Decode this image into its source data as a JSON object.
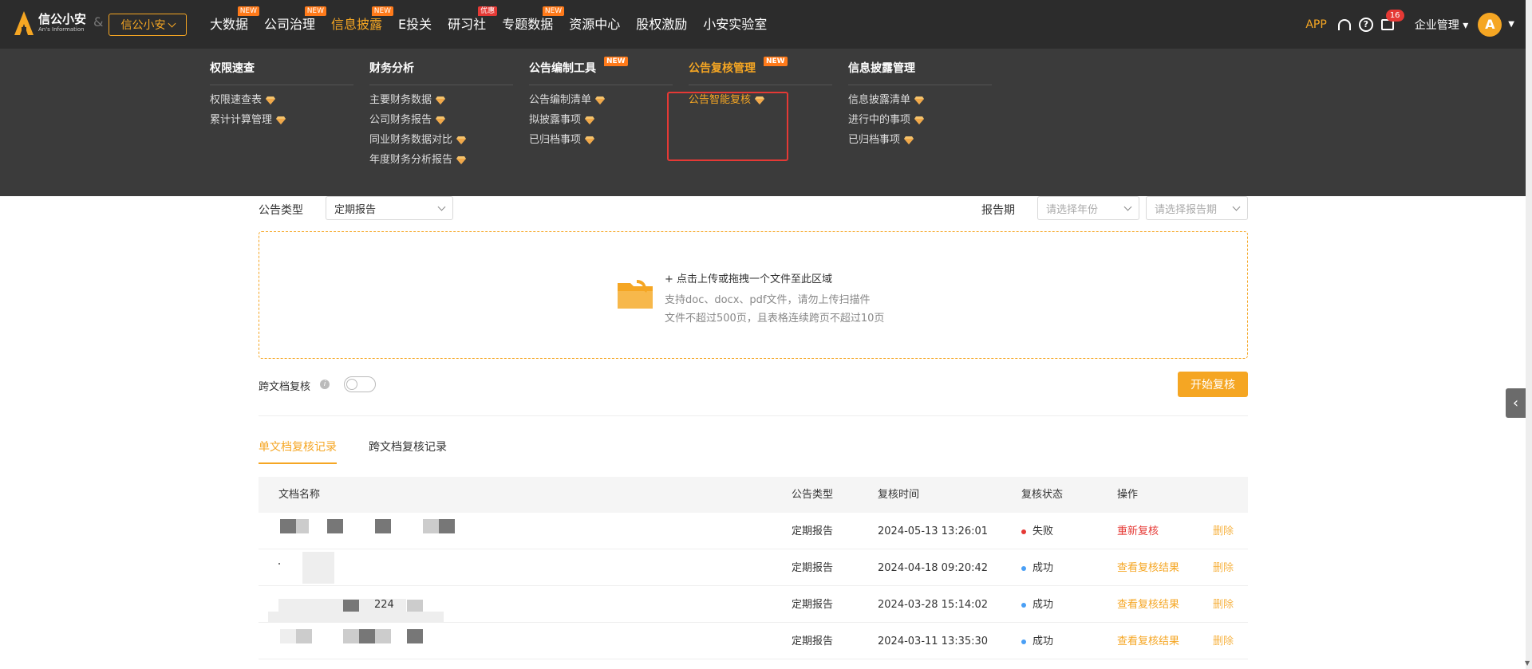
{
  "brand": {
    "logo_cn": "信公小安",
    "logo_en": "An's Information",
    "amp": "&",
    "switch_label": "信公小安"
  },
  "nav": [
    {
      "label": "大数据",
      "tag": "NEW"
    },
    {
      "label": "公司治理",
      "tag": "NEW"
    },
    {
      "label": "信息披露",
      "tag": "NEW",
      "active": true
    },
    {
      "label": "E投关",
      "tag": ""
    },
    {
      "label": "研习社",
      "tag": "优惠"
    },
    {
      "label": "专题数据",
      "tag": "NEW"
    },
    {
      "label": "资源中心",
      "tag": ""
    },
    {
      "label": "股权激励",
      "tag": ""
    },
    {
      "label": "小安实验室",
      "tag": ""
    }
  ],
  "nav_right": {
    "app": "APP",
    "help": "?",
    "message_count": "16",
    "enterprise": "企业管理",
    "avatar_letter": "A"
  },
  "mega": [
    {
      "title": "权限速查",
      "tag": "",
      "items": [
        "权限速查表",
        "累计计算管理"
      ]
    },
    {
      "title": "财务分析",
      "tag": "",
      "items": [
        "主要财务数据",
        "公司财务报告",
        "同业财务数据对比",
        "年度财务分析报告"
      ]
    },
    {
      "title": "公告编制工具",
      "tag": "NEW",
      "items": [
        "公告编制清单",
        "拟披露事项",
        "已归档事项"
      ]
    },
    {
      "title": "公告复核管理",
      "tag": "NEW",
      "items": [
        "公告智能复核"
      ]
    },
    {
      "title": "信息披露管理",
      "tag": "",
      "items": [
        "信息披露清单",
        "进行中的事项",
        "已归档事项"
      ]
    }
  ],
  "filters": {
    "type_label": "公告类型",
    "type_value": "定期报告",
    "period_label": "报告期",
    "year_placeholder": "请选择年份",
    "period_placeholder": "请选择报告期"
  },
  "upload": {
    "title": "+ 点击上传或拖拽一个文件至此区域",
    "tip1": "支持doc、docx、pdf文件，请勿上传扫描件",
    "tip2": "文件不超过500页，且表格连续跨页不超过10页"
  },
  "cross": {
    "label": "跨文档复核",
    "info": "i",
    "start": "开始复核"
  },
  "tabs": [
    "单文档复核记录",
    "跨文档复核记录"
  ],
  "table": {
    "headers": [
      "文档名称",
      "公告类型",
      "复核时间",
      "复核状态",
      "操作"
    ],
    "rows": [
      {
        "name": "",
        "type": "定期报告",
        "time": "2024-05-13 13:26:01",
        "status": "失败",
        "status_color": "#e53935",
        "action": "重新复核",
        "delete": "删除"
      },
      {
        "name": "",
        "type": "定期报告",
        "time": "2024-04-18 09:20:42",
        "status": "成功",
        "status_color": "#4a9ff5",
        "action": "查看复核结果",
        "delete": "删除"
      },
      {
        "name": "224",
        "type": "定期报告",
        "time": "2024-03-28 15:14:02",
        "status": "成功",
        "status_color": "#4a9ff5",
        "action": "查看复核结果",
        "delete": "删除"
      },
      {
        "name": "",
        "type": "定期报告",
        "time": "2024-03-11 13:35:30",
        "status": "成功",
        "status_color": "#4a9ff5",
        "action": "查看复核结果",
        "delete": "删除"
      }
    ]
  }
}
